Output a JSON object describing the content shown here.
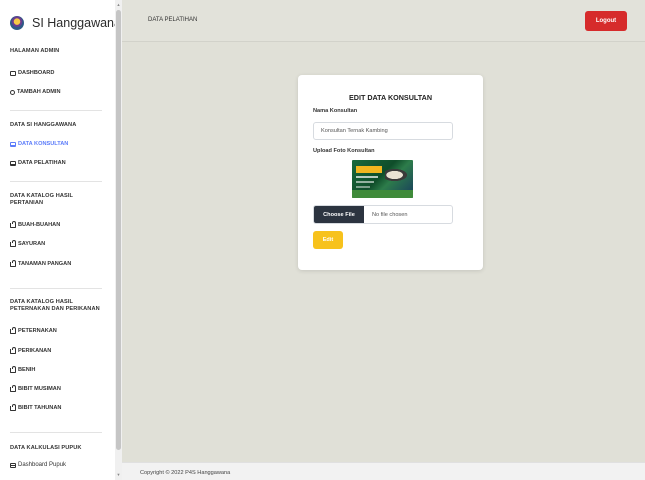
{
  "brand": {
    "title": "SI Hanggawana"
  },
  "sidebar": {
    "sections": [
      {
        "heading": "HALAMAN ADMIN",
        "items": [
          {
            "label": "DASHBOARD",
            "icon": "monitor-icon"
          },
          {
            "label": "TAMBAH ADMIN",
            "icon": "person-icon"
          }
        ]
      },
      {
        "heading": "DATA SI HANGGAWANA",
        "items": [
          {
            "label": "DATA KONSULTAN",
            "icon": "monitor-icon",
            "active": true
          },
          {
            "label": "DATA PELATIHAN",
            "icon": "monitor-icon"
          }
        ]
      },
      {
        "heading": "DATA KATALOG HASIL PERTANIAN",
        "items": [
          {
            "label": "BUAH-BUAHAN",
            "icon": "bag-icon"
          },
          {
            "label": "SAYURAN",
            "icon": "bag-icon"
          },
          {
            "label": "TANAMAN PANGAN",
            "icon": "bag-icon"
          }
        ]
      },
      {
        "heading": "DATA KATALOG HASIL PETERNAKAN DAN PERIKANAN",
        "items": [
          {
            "label": "PETERNAKAN",
            "icon": "bag-icon"
          },
          {
            "label": "PERIKANAN",
            "icon": "bag-icon"
          },
          {
            "label": "BENIH",
            "icon": "bag-icon"
          },
          {
            "label": "BIBIT MUSIMAN",
            "icon": "bag-icon"
          },
          {
            "label": "BIBIT TAHUNAN",
            "icon": "bag-icon"
          }
        ]
      },
      {
        "heading": "DATA KALKULASI PUPUK",
        "items": [
          {
            "label": "Dashboard Pupuk",
            "icon": "grid-icon"
          }
        ]
      }
    ]
  },
  "header": {
    "title": "DATA PELATIHAN",
    "logout_label": "Logout"
  },
  "form": {
    "title": "EDIT DATA KONSULTAN",
    "name_label": "Nama Konsultan",
    "name_value": "Konsultan Ternak Kambing",
    "upload_label": "Upload Foto Konsultan",
    "choose_file_label": "Choose File",
    "no_file_text": "No file chosen",
    "submit_label": "Edit"
  },
  "footer": {
    "text": "Copyright © 2022 P4S Hanggawana"
  },
  "colors": {
    "accent": "#5c7cfa",
    "logout": "#d62b2b",
    "edit": "#f7c21c",
    "choose_file": "#2c3440"
  }
}
